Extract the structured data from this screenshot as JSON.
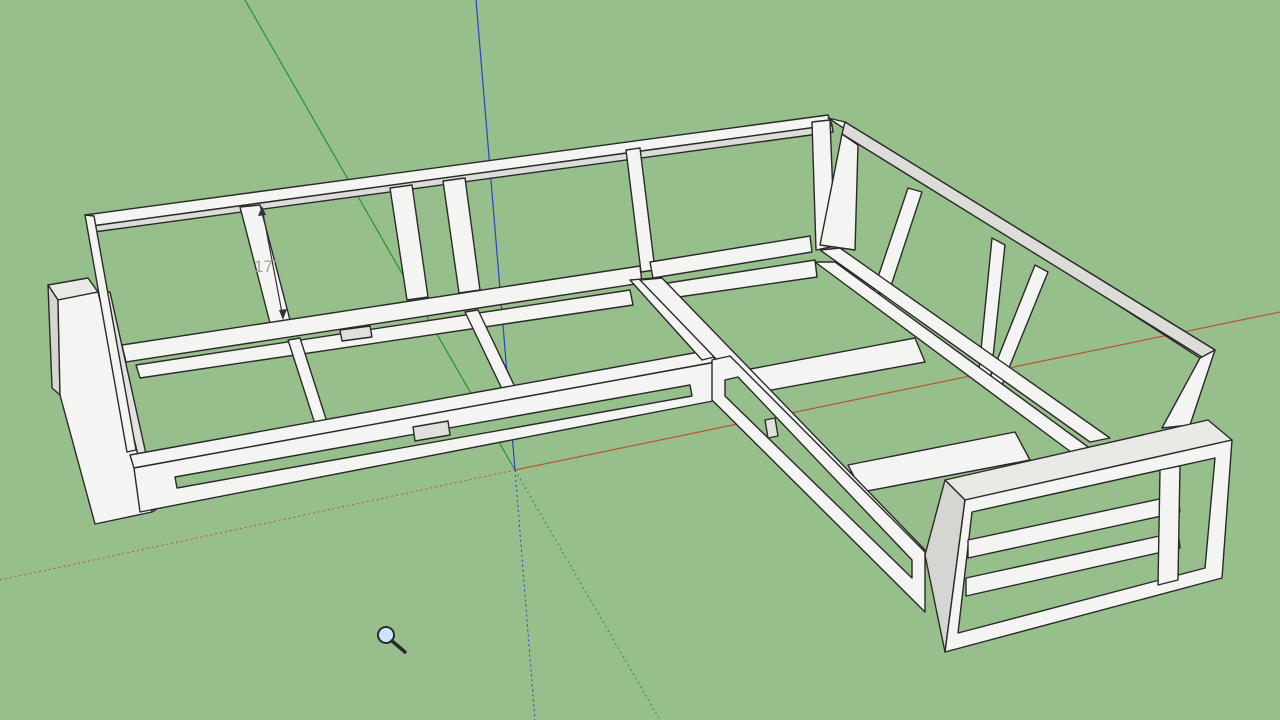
{
  "app": {
    "background_color": "#97bf8c",
    "wood_face_color": "#f4f4f2",
    "wood_edge_color": "#2a2a2a",
    "axis_colors": {
      "red": "#b8552f",
      "green": "#1f9a2a",
      "blue": "#2a3fd0"
    }
  },
  "dimension": {
    "label": "17\""
  },
  "cursor": {
    "icon": "zoom-magnifier-icon"
  }
}
